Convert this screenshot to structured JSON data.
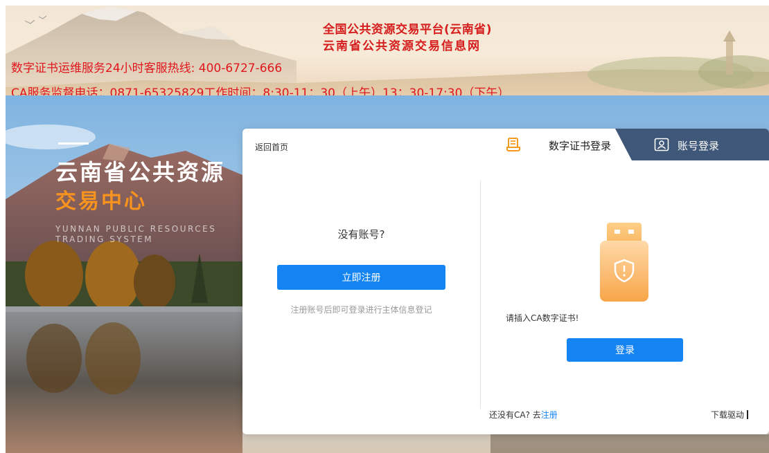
{
  "header": {
    "title_line1": "全国公共资源交易平台(云南省)",
    "title_line2": "云南省公共资源交易信息网",
    "hotline": "数字证书运维服务24小时客服热线: 400-6727-666",
    "supervise": "CA服务监督电话：0871-65325829工作时间：8:30-11：30（上午）13：30-17:30（下午）"
  },
  "brand": {
    "line1": "云南省公共资源",
    "line2": "交易中心",
    "en_line1": "YUNNAN PUBLIC RESOURCES",
    "en_line2": "TRADING SYSTEM"
  },
  "card": {
    "back_home": "返回首页",
    "left": {
      "no_account": "没有账号?",
      "register_button": "立即注册",
      "register_hint": "注册账号后即可登录进行主体信息登记"
    },
    "tabs": {
      "cert_login": "数字证书登录",
      "account_login": "账号登录",
      "active": "cert_login"
    },
    "right": {
      "insert_hint": "请插入CA数字证书!",
      "login_button": "登录",
      "no_ca_prefix": "还没有CA? 去",
      "no_ca_link": "注册",
      "download_driver": "下载驱动"
    }
  },
  "icons": {
    "cert_tab_icon": "certificate-icon",
    "account_tab_icon": "user-card-icon",
    "usb_icon": "usb-key-shield-icon"
  },
  "colors": {
    "primary_button": "#1584f3",
    "header_red": "#d51d1d",
    "brand_orange": "#f7931e",
    "tab_dark": "#3f5778"
  }
}
